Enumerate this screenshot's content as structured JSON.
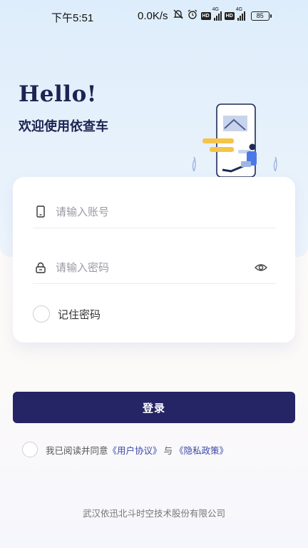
{
  "status_bar": {
    "time": "下午5:51",
    "speed": "0.0K/s",
    "hd1": "HD",
    "net1": "4G",
    "hd2": "HD",
    "net2": "4G",
    "battery": "85"
  },
  "header": {
    "hello": "Hello!",
    "welcome": "欢迎使用依查车"
  },
  "form": {
    "account_placeholder": "请输入账号",
    "account_value": "",
    "password_placeholder": "请输入密码",
    "password_value": "",
    "remember_label": "记住密码",
    "remember_checked": false
  },
  "login_button": "登录",
  "agreement": {
    "prefix": "我已阅读并同意",
    "user_agreement": "《用户协议》",
    "and": "与",
    "privacy_policy": "《隐私政策》",
    "checked": false
  },
  "footer": "武汉依迅北斗时空技术股份有限公司",
  "colors": {
    "primary": "#252465",
    "link": "#3a4aa8",
    "top_background": "#deedfb",
    "title": "#1d2452"
  },
  "icons": {
    "account": "phone-icon",
    "password": "lock-icon",
    "visibility": "eye-icon"
  }
}
